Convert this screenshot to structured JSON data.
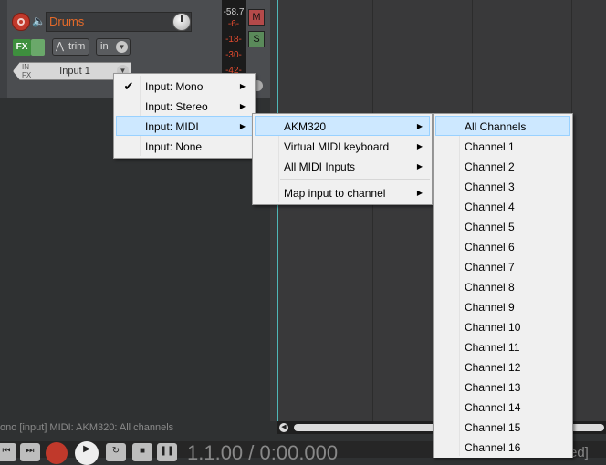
{
  "track": {
    "name": "Drums",
    "fx_label": "FX",
    "trim_label": "trim",
    "in_label": "in",
    "input_tag": "IN FX",
    "input_label": "Input 1",
    "meter": [
      "-58.7",
      "-6-",
      "-18-",
      "-30-",
      "-42-"
    ],
    "mute_label": "M",
    "solo_label": "S"
  },
  "status_bar": {
    "text": "ono [input] MIDI: AKM320: All channels"
  },
  "transport": {
    "time": "1.1.00 / 0:00.000",
    "tail": "ed]"
  },
  "menus": {
    "input": {
      "items": [
        {
          "label": "Input: Mono",
          "checked": true,
          "submenu": true
        },
        {
          "label": "Input: Stereo",
          "submenu": true
        },
        {
          "label": "Input: MIDI",
          "submenu": true,
          "highlighted": true
        },
        {
          "label": "Input: None",
          "submenu": false
        }
      ]
    },
    "midi": {
      "items": [
        {
          "label": "AKM320",
          "submenu": true,
          "highlighted": true
        },
        {
          "label": "Virtual MIDI keyboard",
          "submenu": true
        },
        {
          "label": "All MIDI Inputs",
          "submenu": true
        },
        {
          "label": "Map input to channel",
          "submenu": true
        }
      ]
    },
    "channels": {
      "items": [
        "All Channels",
        "Channel 1",
        "Channel 2",
        "Channel 3",
        "Channel 4",
        "Channel 5",
        "Channel 6",
        "Channel 7",
        "Channel 8",
        "Channel 9",
        "Channel 10",
        "Channel 11",
        "Channel 12",
        "Channel 13",
        "Channel 14",
        "Channel 15",
        "Channel 16"
      ],
      "highlighted_index": 0
    }
  },
  "colors": {
    "menu_highlight": "#cde8ff",
    "track_name": "#e36a2a",
    "edit_cursor": "#4fb7b7"
  }
}
